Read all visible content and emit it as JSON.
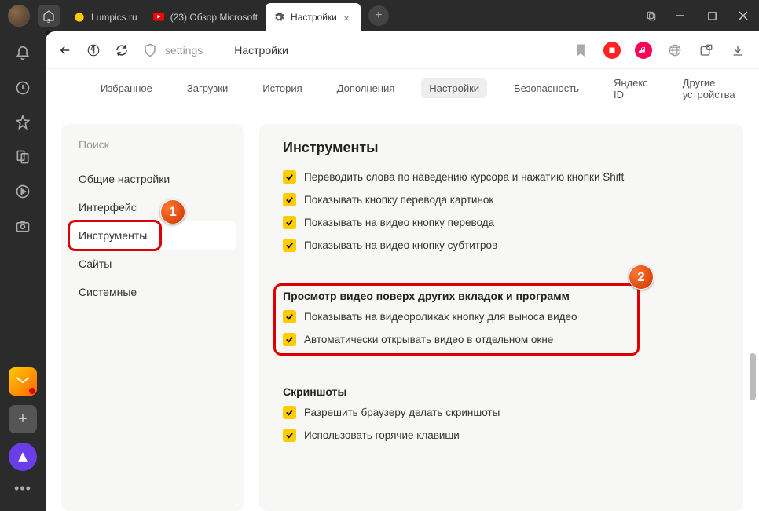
{
  "titlebar": {
    "home_badge": "3",
    "tabs": [
      {
        "label": "Lumpics.ru",
        "icon": "lumpics"
      },
      {
        "label": "(23) Обзор Microsoft",
        "icon": "youtube"
      },
      {
        "label": "Настройки",
        "icon": "gear",
        "active": true
      }
    ]
  },
  "addr": {
    "url_text": "settings",
    "page_title": "Настройки"
  },
  "subnav": [
    "Избранное",
    "Загрузки",
    "История",
    "Дополнения",
    "Настройки",
    "Безопасность",
    "Яндекс ID",
    "Другие устройства"
  ],
  "settings_nav": {
    "search_placeholder": "Поиск",
    "items": [
      "Общие настройки",
      "Интерфейс",
      "Инструменты",
      "Сайты",
      "Системные"
    ]
  },
  "panel": {
    "section1_title": "Инструменты",
    "section1_checks": [
      "Переводить слова по наведению курсора и нажатию кнопки Shift",
      "Показывать кнопку перевода картинок",
      "Показывать на видео кнопку перевода",
      "Показывать на видео кнопку субтитров"
    ],
    "section2_title": "Просмотр видео поверх других вкладок и программ",
    "section2_checks": [
      "Показывать на видеороликах кнопку для выноса видео",
      "Автоматически открывать видео в отдельном окне"
    ],
    "section3_title": "Скриншоты",
    "section3_checks": [
      "Разрешить браузеру делать скриншоты",
      "Использовать горячие клавиши"
    ]
  },
  "callouts": {
    "one": "1",
    "two": "2"
  }
}
